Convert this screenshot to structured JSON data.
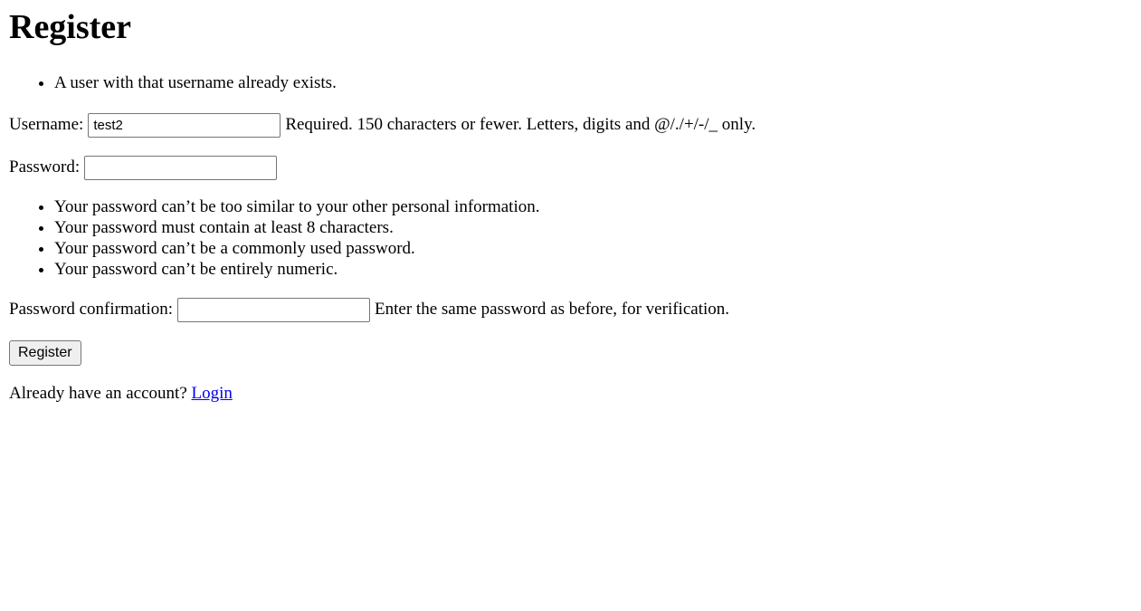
{
  "title": "Register",
  "errors": [
    "A user with that username already exists."
  ],
  "username": {
    "label": "Username:",
    "value": "test2",
    "help": "Required. 150 characters or fewer. Letters, digits and @/./+/-/_ only."
  },
  "password": {
    "label": "Password:",
    "value": "",
    "help_items": [
      "Your password can’t be too similar to your other personal information.",
      "Your password must contain at least 8 characters.",
      "Your password can’t be a commonly used password.",
      "Your password can’t be entirely numeric."
    ]
  },
  "password_confirmation": {
    "label": "Password confirmation:",
    "value": "",
    "help": "Enter the same password as before, for verification."
  },
  "submit_label": "Register",
  "login_prompt": "Already have an account?",
  "login_link": "Login"
}
